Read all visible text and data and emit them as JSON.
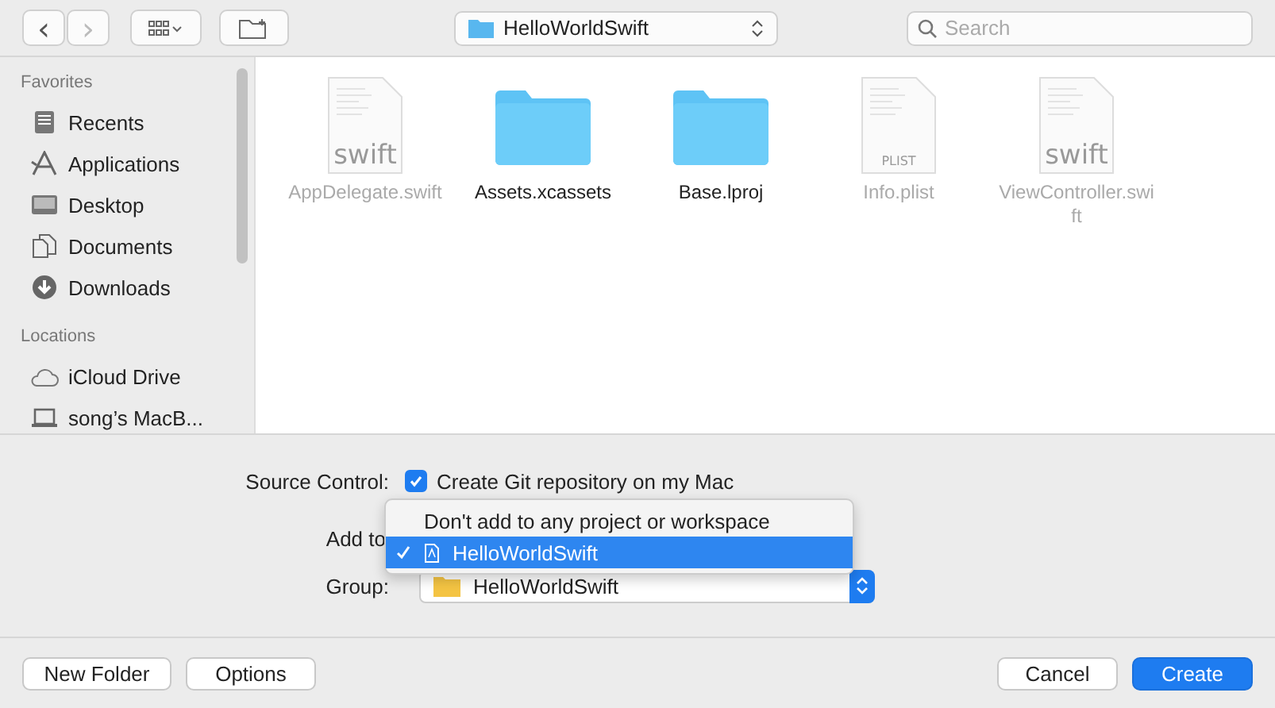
{
  "toolbar": {
    "back": "‹",
    "forward": "›",
    "location": "HelloWorldSwift",
    "search": {
      "placeholder": "Search"
    }
  },
  "sidebar": {
    "sections": [
      {
        "title": "Favorites",
        "items": [
          {
            "label": "Recents",
            "kind": "recents"
          },
          {
            "label": "Applications",
            "kind": "apps"
          },
          {
            "label": "Desktop",
            "kind": "desktop"
          },
          {
            "label": "Documents",
            "kind": "documents"
          },
          {
            "label": "Downloads",
            "kind": "downloads"
          }
        ]
      },
      {
        "title": "Locations",
        "items": [
          {
            "label": "iCloud Drive",
            "kind": "cloud"
          },
          {
            "label": "song’s MacB...",
            "kind": "laptop"
          }
        ]
      }
    ]
  },
  "files": [
    {
      "name": "AppDelegate.swift",
      "kind": "swift",
      "icon_text": "swift",
      "dimmed": true
    },
    {
      "name": "Assets.xcassets",
      "kind": "folder",
      "dimmed": false
    },
    {
      "name": "Base.lproj",
      "kind": "folder",
      "dimmed": false
    },
    {
      "name": "Info.plist",
      "kind": "plist",
      "icon_text": "PLIST",
      "dimmed": true
    },
    {
      "name": "ViewController.swift",
      "kind": "swift",
      "icon_text": "swift",
      "dimmed": true
    }
  ],
  "options": {
    "source_control_label": "Source Control:",
    "git": {
      "label": "Create Git repository on my Mac",
      "checked": true
    },
    "add_to_label": "Add to",
    "menu": [
      {
        "label": "Don't add to any project or workspace",
        "selected": false,
        "icon": false
      },
      {
        "label": "HelloWorldSwift",
        "selected": true,
        "icon": true
      }
    ],
    "group_label": "Group:",
    "group_value": "HelloWorldSwift"
  },
  "buttons": {
    "new_folder": "New Folder",
    "options": "Options",
    "cancel": "Cancel",
    "create": "Create"
  }
}
